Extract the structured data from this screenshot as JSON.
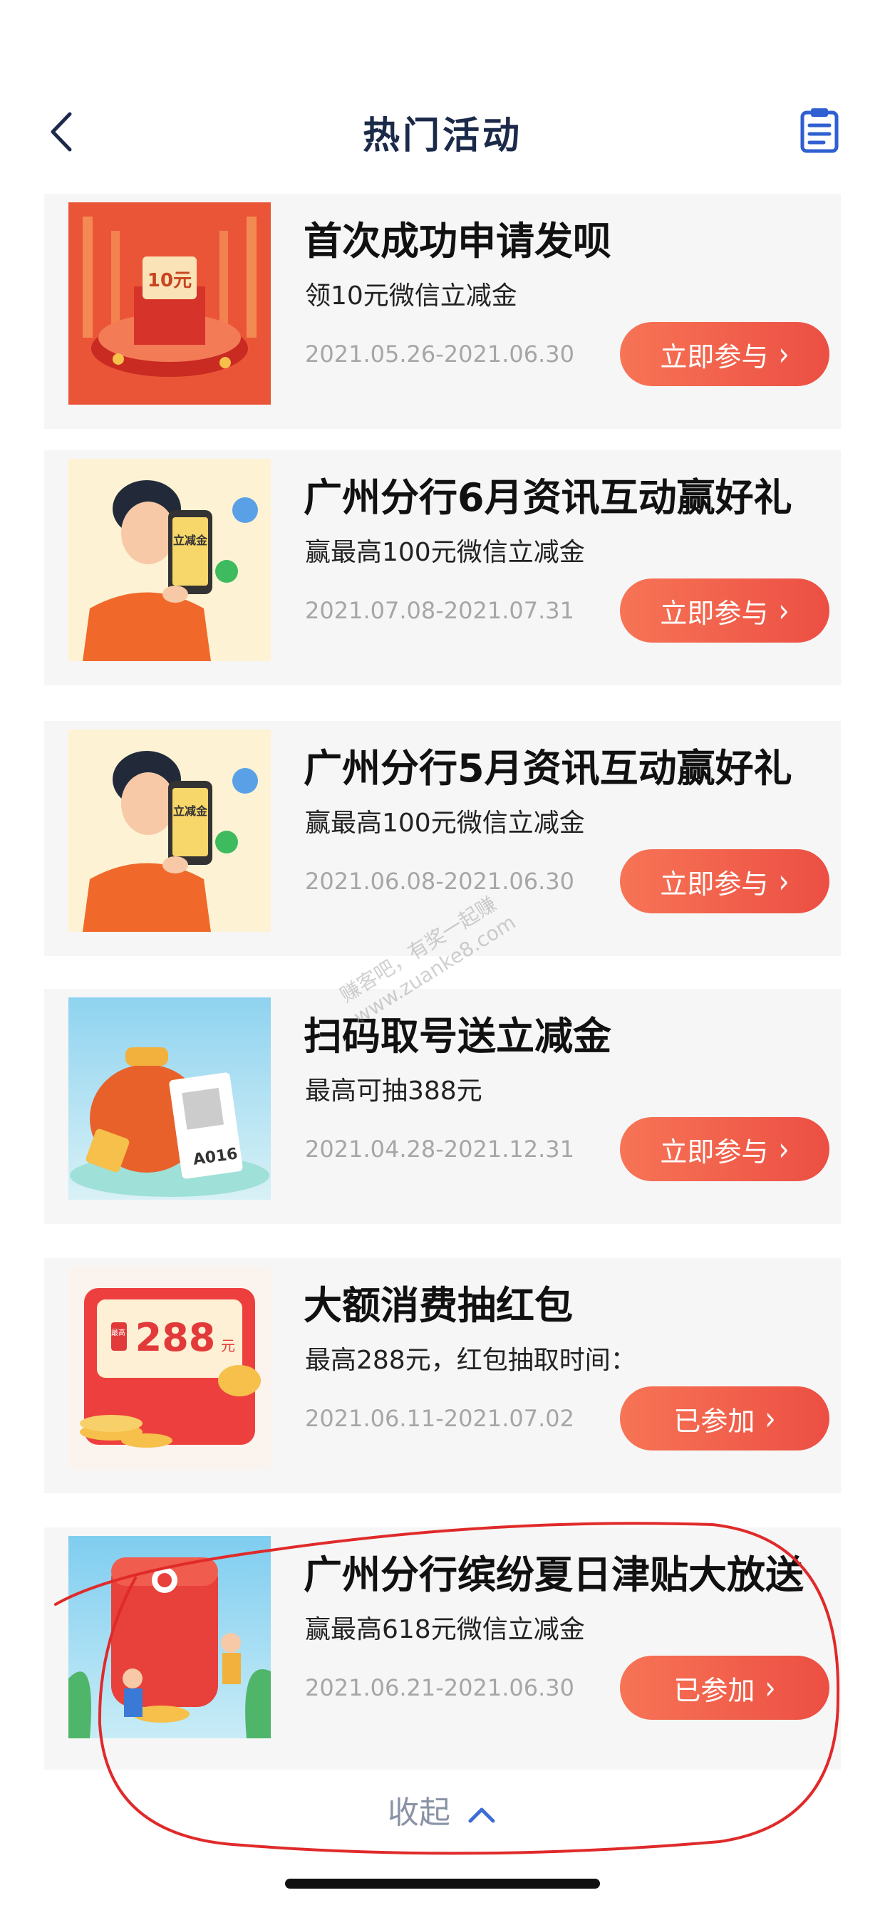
{
  "header": {
    "title": "热门活动",
    "back_icon": "chevron-left-icon",
    "right_icon": "clipboard-icon"
  },
  "colors": {
    "button_start": "#f77456",
    "button_end": "#ec4f43",
    "title_navy": "#1c2a4a",
    "date_gray": "#a6a6a6",
    "annotation_red": "#e02a2a"
  },
  "activities": [
    {
      "title": "首次成功申请发呗",
      "subtitle": "领10元微信立减金",
      "dates": "2021.05.26-2021.06.30",
      "button": "立即参与",
      "thumb_text": "10元"
    },
    {
      "title": "广州分行6月资讯互动赢好礼",
      "subtitle": "赢最高100元微信立减金",
      "dates": "2021.07.08-2021.07.31",
      "button": "立即参与",
      "thumb_text": "立减金"
    },
    {
      "title": "广州分行5月资讯互动赢好礼",
      "subtitle": "赢最高100元微信立减金",
      "dates": "2021.06.08-2021.06.30",
      "button": "立即参与",
      "thumb_text": "立减金"
    },
    {
      "title": "扫码取号送立减金",
      "subtitle": "最高可抽388元",
      "dates": "2021.04.28-2021.12.31",
      "button": "立即参与",
      "thumb_text": "A016"
    },
    {
      "title": "大额消费抽红包",
      "subtitle": "最高288元，红包抽取时间：",
      "dates": "2021.06.11-2021.07.02",
      "button": "已参加",
      "thumb_text": "288",
      "thumb_badge": "最高",
      "thumb_unit": "元"
    },
    {
      "title": "广州分行缤纷夏日津贴大放送",
      "subtitle": "赢最高618元微信立减金",
      "dates": "2021.06.21-2021.06.30",
      "button": "已参加"
    }
  ],
  "collapse_label": "收起",
  "collapse_icon": "chevron-up-icon",
  "watermark": [
    "赚客吧，有奖一起赚",
    "www.zuanke8.com"
  ]
}
